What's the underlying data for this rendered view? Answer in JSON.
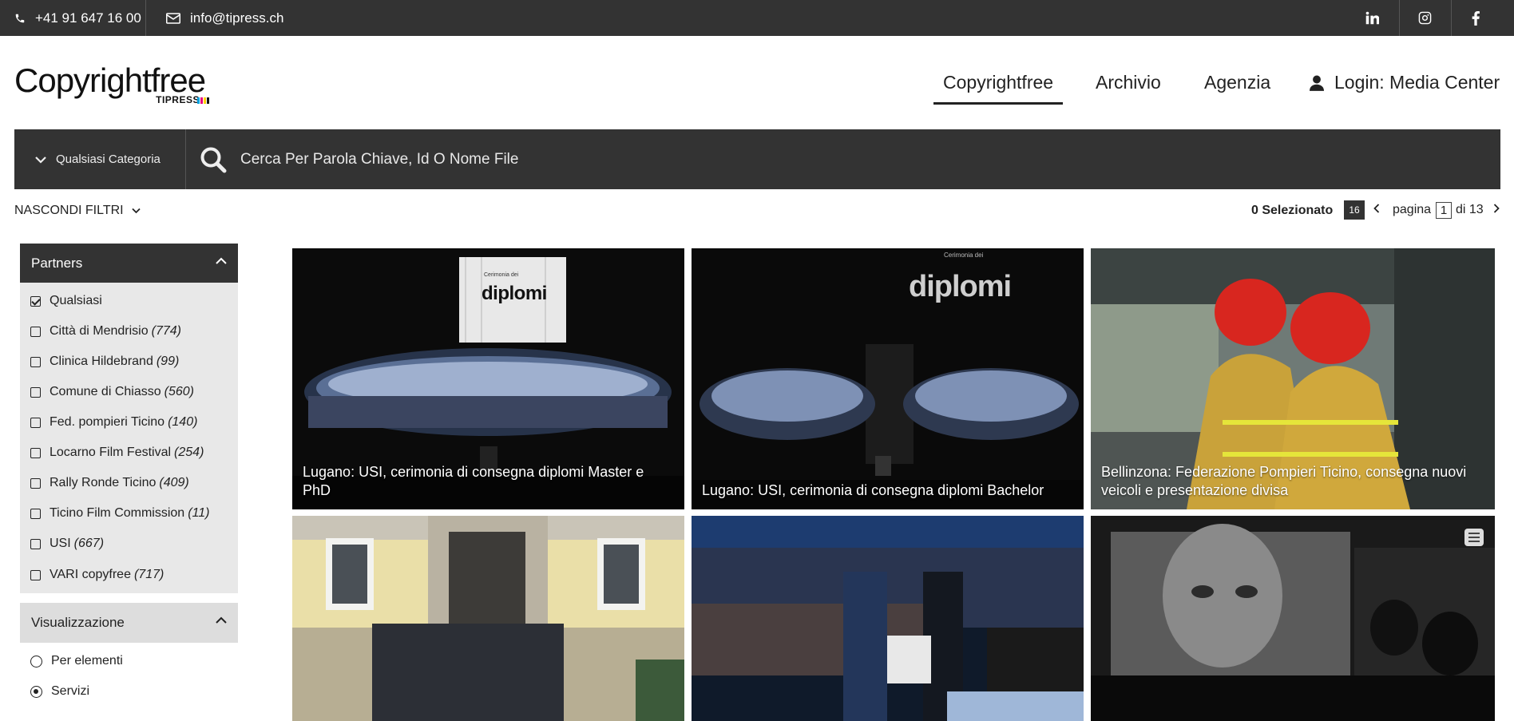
{
  "topbar": {
    "phone": "+41 91 647 16 00",
    "email": "info@tipress.ch",
    "social": [
      "linkedin-icon",
      "instagram-icon",
      "facebook-icon"
    ]
  },
  "logo": {
    "word": "Copyrightfree",
    "sub": "TIPRESS",
    "bar_colors": [
      "#00a0e0",
      "#e6007e",
      "#ffd400",
      "#111111"
    ]
  },
  "nav": {
    "items": [
      "Copyrightfree",
      "Archivio",
      "Agenzia"
    ],
    "login": "Login: Media Center"
  },
  "search": {
    "category": "Qualsiasi Categoria",
    "placeholder": "Cerca Per Parola Chiave, Id O Nome File"
  },
  "toolbar": {
    "hide_filters": "NASCONDI FILTRI",
    "selected": "0 Selezionato",
    "per_page": "16",
    "page_label": "pagina",
    "page_current": "1",
    "page_of": "di 13"
  },
  "sidebar": {
    "partners_title": "Partners",
    "partners": [
      {
        "label": "Qualsiasi",
        "count": "",
        "checked": true
      },
      {
        "label": "Città di Mendrisio",
        "count": "(774)",
        "checked": false
      },
      {
        "label": "Clinica Hildebrand",
        "count": "(99)",
        "checked": false
      },
      {
        "label": "Comune di Chiasso",
        "count": "(560)",
        "checked": false
      },
      {
        "label": "Fed. pompieri Ticino",
        "count": "(140)",
        "checked": false
      },
      {
        "label": "Locarno Film Festival",
        "count": "(254)",
        "checked": false
      },
      {
        "label": "Rally Ronde Ticino",
        "count": "(409)",
        "checked": false
      },
      {
        "label": "Ticino Film Commission",
        "count": "(11)",
        "checked": false
      },
      {
        "label": "USI",
        "count": "(667)",
        "checked": false
      },
      {
        "label": "VARI copyfree",
        "count": "(717)",
        "checked": false
      }
    ],
    "view_title": "Visualizzazione",
    "view_options": [
      {
        "label": "Per elementi",
        "selected": false
      },
      {
        "label": "Servizi",
        "selected": true
      }
    ]
  },
  "grid": {
    "cards": [
      {
        "caption": "Lugano: USI, cerimonia di consegna diplomi Master e PhD",
        "screen_title": "diplomi",
        "screen_sub": "Cerimonia dei"
      },
      {
        "caption": "Lugano: USI, cerimonia di consegna diplomi Bachelor",
        "screen_title": "diplomi",
        "screen_sub": "Cerimonia dei"
      },
      {
        "caption": "Bellinzona: Federazione Pompieri Ticino, consegna nuovi veicoli e presentazione divisa"
      },
      {
        "caption": ""
      },
      {
        "caption": ""
      },
      {
        "caption": ""
      }
    ]
  }
}
